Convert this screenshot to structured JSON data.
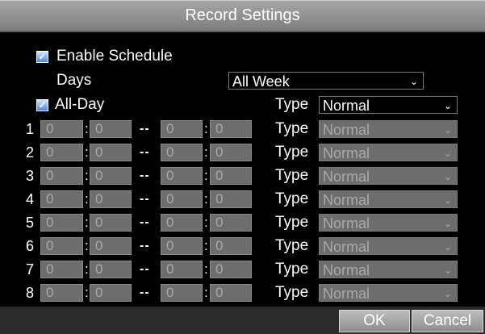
{
  "title": "Record Settings",
  "enable_schedule": {
    "label": "Enable Schedule",
    "checked": true
  },
  "days": {
    "label": "Days",
    "value": "All Week"
  },
  "all_day": {
    "label": "All-Day",
    "checked": true,
    "type_label": "Type",
    "type_value": "Normal"
  },
  "periods": [
    {
      "num": "1",
      "start_h": "0",
      "start_m": "0",
      "end_h": "0",
      "end_m": "0",
      "type_label": "Type",
      "type_value": "Normal"
    },
    {
      "num": "2",
      "start_h": "0",
      "start_m": "0",
      "end_h": "0",
      "end_m": "0",
      "type_label": "Type",
      "type_value": "Normal"
    },
    {
      "num": "3",
      "start_h": "0",
      "start_m": "0",
      "end_h": "0",
      "end_m": "0",
      "type_label": "Type",
      "type_value": "Normal"
    },
    {
      "num": "4",
      "start_h": "0",
      "start_m": "0",
      "end_h": "0",
      "end_m": "0",
      "type_label": "Type",
      "type_value": "Normal"
    },
    {
      "num": "5",
      "start_h": "0",
      "start_m": "0",
      "end_h": "0",
      "end_m": "0",
      "type_label": "Type",
      "type_value": "Normal"
    },
    {
      "num": "6",
      "start_h": "0",
      "start_m": "0",
      "end_h": "0",
      "end_m": "0",
      "type_label": "Type",
      "type_value": "Normal"
    },
    {
      "num": "7",
      "start_h": "0",
      "start_m": "0",
      "end_h": "0",
      "end_m": "0",
      "type_label": "Type",
      "type_value": "Normal"
    },
    {
      "num": "8",
      "start_h": "0",
      "start_m": "0",
      "end_h": "0",
      "end_m": "0",
      "type_label": "Type",
      "type_value": "Normal"
    }
  ],
  "time_separator": ":",
  "range_separator": "--",
  "buttons": {
    "ok": "OK",
    "cancel": "Cancel"
  },
  "icons": {
    "checkbox_checked": "checkmark-icon",
    "dropdown_arrow": "chevron-down-icon"
  },
  "colors": {
    "checkbox": "#4b86e6",
    "disabled_field": "#6d6d6d",
    "titlebar": "#8e8e8e"
  }
}
